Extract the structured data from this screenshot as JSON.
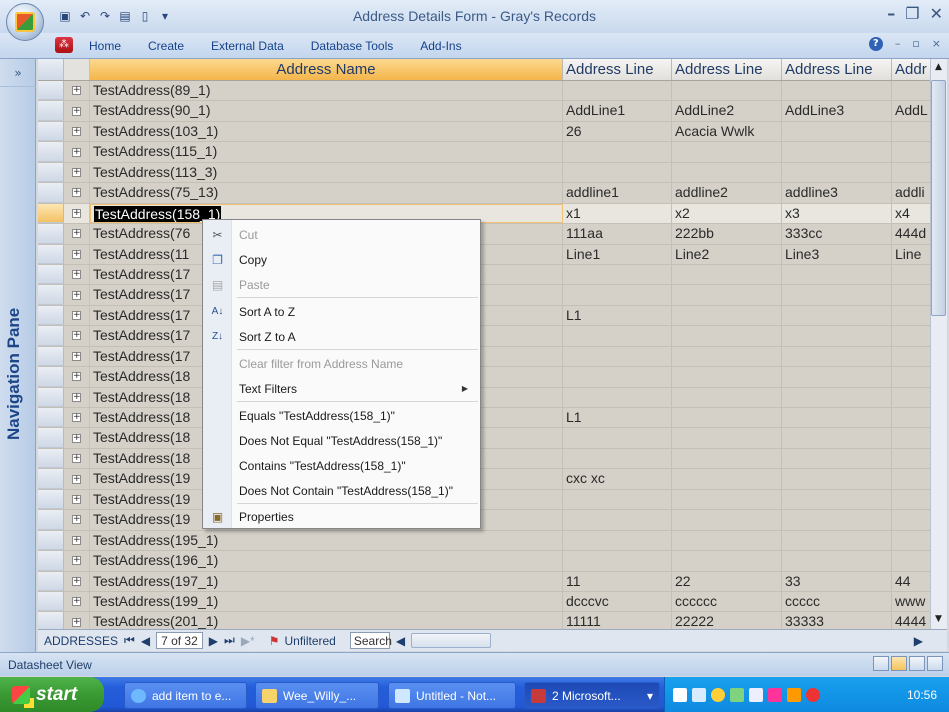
{
  "window": {
    "title": "Address Details Form - Gray's Records"
  },
  "ribbon": {
    "tabs": [
      "Home",
      "Create",
      "External Data",
      "Database Tools",
      "Add-Ins"
    ]
  },
  "nav_pane": {
    "collapse_label": "»",
    "label": "Navigation Pane"
  },
  "grid": {
    "columns": [
      "Address Name",
      "Address Line",
      "Address Line",
      "Address Line",
      "Addr"
    ],
    "rows": [
      [
        "TestAddress(89_1)",
        "",
        "",
        "",
        ""
      ],
      [
        "TestAddress(90_1)",
        "AddLine1",
        "AddLine2",
        "AddLine3",
        "AddL"
      ],
      [
        "TestAddress(103_1)",
        "26",
        "Acacia Wwlk",
        "",
        ""
      ],
      [
        "TestAddress(115_1)",
        "",
        "",
        "",
        ""
      ],
      [
        "TestAddress(113_3)",
        "",
        "",
        "",
        ""
      ],
      [
        "TestAddress(75_13)",
        "addline1",
        "addline2",
        "addline3",
        "addli"
      ],
      [
        "TestAddress(158_1)",
        "x1",
        "x2",
        "x3",
        "x4"
      ],
      [
        "TestAddress(76",
        "111aa",
        "222bb",
        "333cc",
        "444d"
      ],
      [
        "TestAddress(11",
        "Line1",
        "Line2",
        "Line3",
        "Line"
      ],
      [
        "TestAddress(17",
        "",
        "",
        "",
        ""
      ],
      [
        "TestAddress(17",
        "",
        "",
        "",
        ""
      ],
      [
        "TestAddress(17",
        "L1",
        "",
        "",
        ""
      ],
      [
        "TestAddress(17",
        "",
        "",
        "",
        ""
      ],
      [
        "TestAddress(17",
        "",
        "",
        "",
        ""
      ],
      [
        "TestAddress(18",
        "",
        "",
        "",
        ""
      ],
      [
        "TestAddress(18",
        "",
        "",
        "",
        ""
      ],
      [
        "TestAddress(18",
        "L1",
        "",
        "",
        ""
      ],
      [
        "TestAddress(18",
        "",
        "",
        "",
        ""
      ],
      [
        "TestAddress(18",
        "",
        "",
        "",
        ""
      ],
      [
        "TestAddress(19",
        "cxc xc",
        "",
        "",
        ""
      ],
      [
        "TestAddress(19",
        "",
        "",
        "",
        ""
      ],
      [
        "TestAddress(19",
        "",
        "",
        "",
        ""
      ],
      [
        "TestAddress(195_1)",
        "",
        "",
        "",
        ""
      ],
      [
        "TestAddress(196_1)",
        "",
        "",
        "",
        ""
      ],
      [
        "TestAddress(197_1)",
        "11",
        "22",
        "33",
        "44"
      ],
      [
        "TestAddress(199_1)",
        "dcccvc",
        "cccccc",
        "ccccc",
        "www"
      ],
      [
        "TestAddress(201_1)",
        "11111",
        "22222",
        "33333",
        "4444"
      ]
    ]
  },
  "record_nav": {
    "table": "ADDRESSES",
    "first": "⏮",
    "prev": "◀",
    "position": "7 of 32",
    "next": "▶",
    "last": "⏭",
    "new": "▶*",
    "filter": "Unfiltered",
    "search": "Search"
  },
  "context_menu": {
    "items": [
      {
        "label": "Cut",
        "icon": "scissors-icon",
        "enabled": false
      },
      {
        "label": "Copy",
        "icon": "copy-icon",
        "enabled": true
      },
      {
        "label": "Paste",
        "icon": "paste-icon",
        "enabled": false
      },
      {
        "label": "Sort A to Z",
        "icon": "sort-asc-icon",
        "enabled": true
      },
      {
        "label": "Sort Z to A",
        "icon": "sort-desc-icon",
        "enabled": true
      },
      {
        "label": "Clear filter from Address Name",
        "icon": "",
        "enabled": false
      },
      {
        "label": "Text Filters",
        "icon": "",
        "enabled": true,
        "submenu": true
      },
      {
        "label": "Equals \"TestAddress(158_1)\"",
        "icon": "",
        "enabled": true
      },
      {
        "label": "Does Not Equal \"TestAddress(158_1)\"",
        "icon": "",
        "enabled": true
      },
      {
        "label": "Contains \"TestAddress(158_1)\"",
        "icon": "",
        "enabled": true
      },
      {
        "label": "Does Not Contain \"TestAddress(158_1)\"",
        "icon": "",
        "enabled": true
      },
      {
        "label": "Properties",
        "icon": "properties-icon",
        "enabled": true
      }
    ]
  },
  "status_bar": {
    "text": "Datasheet View"
  },
  "taskbar": {
    "start": "start",
    "tasks": [
      "add item to e...",
      "Wee_Willy_...",
      "Untitled - Not...",
      "2 Microsoft..."
    ],
    "clock": "10:56"
  },
  "colors": {
    "selected_header": "#f4b54b",
    "nav_pane_text": "#1d4689",
    "taskbar": "#245edb",
    "start_button": "#3a9a33"
  }
}
